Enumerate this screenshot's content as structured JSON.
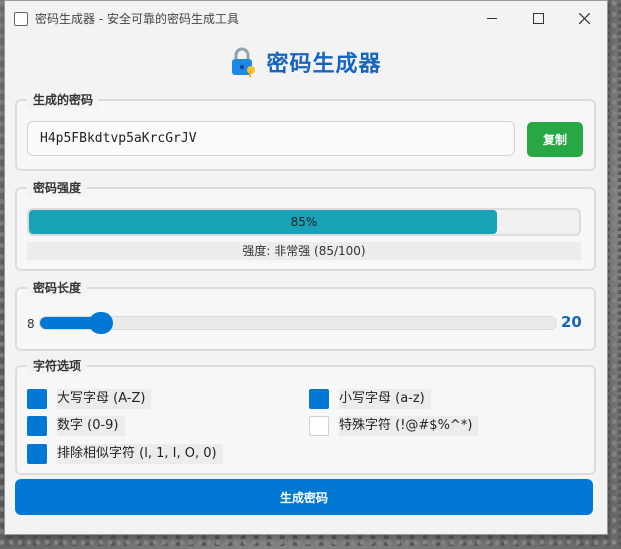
{
  "window": {
    "title": "密码生成器 - 安全可靠的密码生成工具",
    "minimize_icon": "minimize-icon",
    "maximize_icon": "maximize-icon",
    "close_icon": "close-icon"
  },
  "header": {
    "title": "密码生成器",
    "icon": "lock-icon"
  },
  "password_group": {
    "label": "生成的密码",
    "value": "H4p5FBkdtvp5aKrcGrJV",
    "copy_label": "复制",
    "copy_color": "#28a745"
  },
  "strength_group": {
    "label": "密码强度",
    "percent": 85,
    "percent_text": "85%",
    "strength_text": "强度: 非常强 (85/100)",
    "fill_color": "#17a2b8"
  },
  "length_group": {
    "label": "密码长度",
    "min_text": "8",
    "min": 8,
    "max": 128,
    "value": 20,
    "value_text": "20"
  },
  "options_group": {
    "label": "字符选项",
    "options": [
      {
        "label": "大写字母 (A-Z)",
        "checked": true
      },
      {
        "label": "小写字母 (a-z)",
        "checked": true
      },
      {
        "label": "数字 (0-9)",
        "checked": true
      },
      {
        "label": "特殊字符 (!@#$%^*)",
        "checked": false
      },
      {
        "label": "排除相似字符 (l, 1, I, O, 0)",
        "checked": true
      }
    ]
  },
  "generate_label": "生成密码",
  "accent_color": "#0078d4"
}
